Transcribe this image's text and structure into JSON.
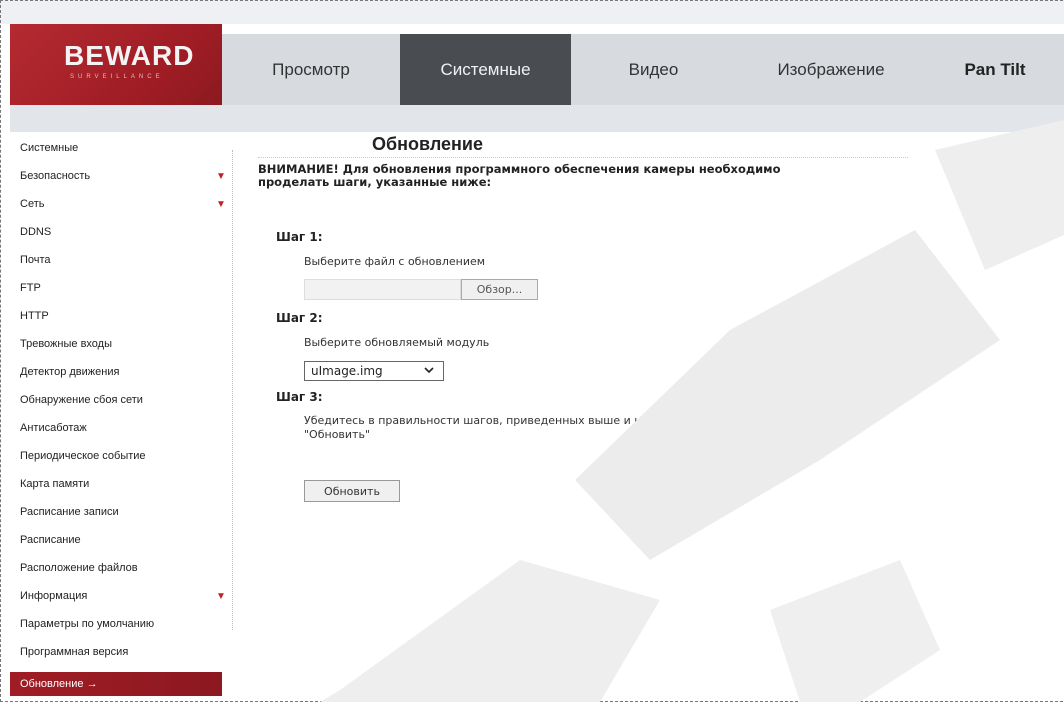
{
  "logo": {
    "brand": "BEWARD",
    "tagline": "SURVEILLANCE"
  },
  "nav": {
    "tabs": [
      {
        "label": "Просмотр"
      },
      {
        "label": "Системные"
      },
      {
        "label": "Видео"
      },
      {
        "label": "Изображение"
      },
      {
        "label": "Pan Tilt"
      }
    ],
    "active_tab": "Системные"
  },
  "sidebar": {
    "items": [
      {
        "label": "Системные"
      },
      {
        "label": "Безопасность",
        "arrow": "▼"
      },
      {
        "label": "Сеть",
        "arrow": "▼"
      },
      {
        "label": "DDNS"
      },
      {
        "label": "Почта"
      },
      {
        "label": "FTP"
      },
      {
        "label": "HTTP"
      },
      {
        "label": "Тревожные входы"
      },
      {
        "label": "Детектор движения"
      },
      {
        "label": "Обнаружение сбоя сети"
      },
      {
        "label": "Антисаботаж"
      },
      {
        "label": "Периодическое событие"
      },
      {
        "label": "Карта памяти"
      },
      {
        "label": "Расписание записи"
      },
      {
        "label": "Расписание"
      },
      {
        "label": "Расположение файлов"
      },
      {
        "label": "Информация",
        "arrow": "▼"
      },
      {
        "label": "Параметры по умолчанию"
      },
      {
        "label": "Программная версия"
      },
      {
        "label": "Обновление →"
      }
    ],
    "active_item": "Обновление →"
  },
  "content": {
    "title": "Обновление",
    "warning_line1": "ВНИМАНИЕ! Для обновления программного обеспечения камеры необходимо",
    "warning_line2": "проделать шаги, указанные ниже:",
    "step1_label": "Шаг 1:",
    "step1_text": "Выберите файл с обновлением",
    "browse_label": "Обзор...",
    "step2_label": "Шаг 2:",
    "step2_text": "Выберите обновляемый модуль",
    "module_selected": "uImage.img",
    "step3_label": "Шаг 3:",
    "step3_text_line1": "Убедитесь в правильности шагов, приведенных выше и нажмите кнопку",
    "step3_text_line2": "\"Обновить\"",
    "update_button": "Обновить"
  },
  "colors": {
    "brand_red": "#a01d25",
    "active_tab": "#494d52",
    "nav_bg": "#d7dbe0"
  }
}
